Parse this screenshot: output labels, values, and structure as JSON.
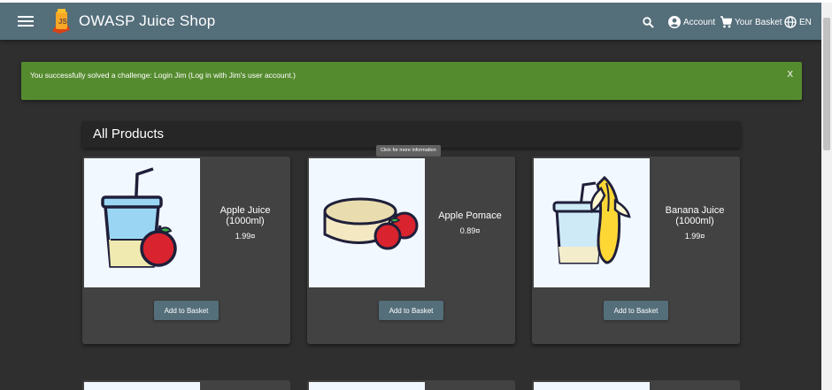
{
  "header": {
    "title": "OWASP Juice Shop",
    "account_label": "Account",
    "basket_label": "Your Basket",
    "language_label": "EN",
    "toolbar_color": "#546e7a"
  },
  "snackbar": {
    "message": "You successfully solved a challenge: Login Jim (Log in with Jim's user account.)",
    "close_label": "X",
    "color": "#558b2f"
  },
  "products": {
    "heading": "All Products",
    "tooltip": "Click for more information",
    "add_label": "Add to Basket",
    "items": [
      {
        "name": "Apple Juice (1000ml)",
        "price": "1.99¤"
      },
      {
        "name": "Apple Pomace",
        "price": "0.89¤"
      },
      {
        "name": "Banana Juice (1000ml)",
        "price": "1.99¤"
      }
    ]
  }
}
